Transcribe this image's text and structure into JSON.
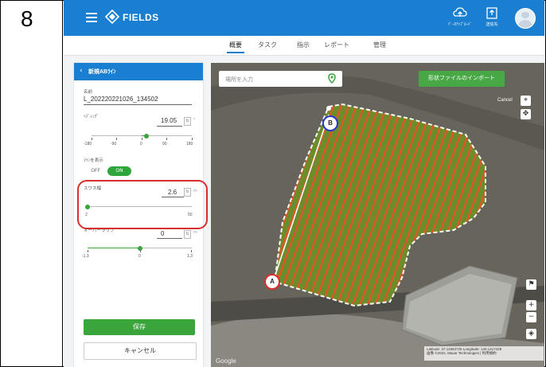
{
  "step_number": "8",
  "app": {
    "brand": "FIELDS",
    "header_buttons": [
      {
        "label": "ﾃﾞｰﾀｱｯﾌﾟﾛｰﾄﾞ",
        "icon": "cloud-upload-icon"
      },
      {
        "label": "送信先",
        "icon": "export-icon"
      }
    ],
    "avatar_icon": "user-avatar-icon"
  },
  "nav": {
    "tabs": [
      "概要",
      "タスク",
      "指示",
      "レポート",
      "管理"
    ],
    "active": "概要"
  },
  "panel": {
    "title": "新規ABﾗｲﾝ",
    "name_label": "名前",
    "name_value": "L_202220221026_134502",
    "heading_label": "ﾍﾃﾞｨﾝｸﾞ",
    "heading_value": "19.05",
    "heading_unit": "°",
    "heading_slider": {
      "min": "-180",
      "max": "180",
      "ticks": [
        "-180",
        "-90",
        "0",
        "90",
        "180"
      ],
      "value": 19.05
    },
    "show_line_label": "ﾗｲﾝを表示",
    "toggle_off": "OFF",
    "toggle_on": "ON",
    "swath_label": "スワス幅",
    "swath_value": "2.6",
    "swath_unit": "m",
    "swath_slider": {
      "min": "2",
      "max": "50",
      "value": 2.6
    },
    "overlap_label": "オーバーラップ",
    "overlap_value": "0",
    "overlap_unit": "m",
    "overlap_slider": {
      "ticks": [
        "-1.3",
        "0",
        "1.3"
      ],
      "value": 0
    },
    "save_label": "保存",
    "cancel_label": "キャンセル"
  },
  "map": {
    "search_placeholder": "場所を入力",
    "import_label": "形状ファイルのインポート",
    "cancel_label": "Cancel",
    "marker_a": "A",
    "marker_b": "B",
    "zoom_in": "+",
    "zoom_out": "−",
    "coords_text": "Latitude: 37.11963725  Longitude: 140.1417428",
    "attribution_text": "画像 ©2022, Maxar Technologies | 利用規約",
    "google_label": "Google",
    "colors": {
      "field_fill": "#6b8d2a",
      "stripes": "#e0552a",
      "boundary": "#ffffff",
      "accent": "#1a7fd0",
      "save": "#3aa53a",
      "highlight": "#d92e2e"
    }
  }
}
